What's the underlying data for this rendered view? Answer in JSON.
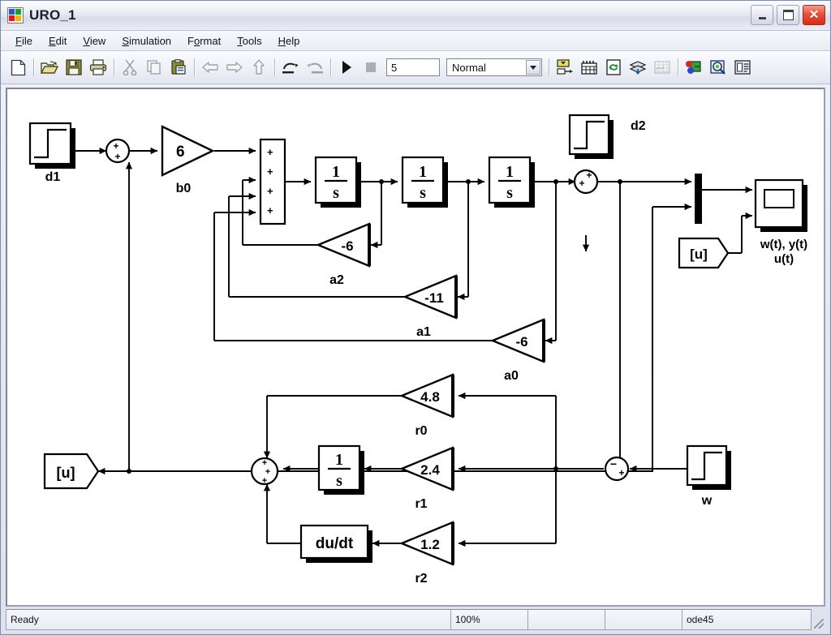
{
  "window": {
    "title": "URO_1",
    "icon": "simulink-model-icon",
    "buttons": {
      "minimize": "minimize-button",
      "maximize": "maximize-button",
      "close": "close-button"
    }
  },
  "menu": {
    "items": [
      {
        "label": "File",
        "mnemonic": "F"
      },
      {
        "label": "Edit",
        "mnemonic": "E"
      },
      {
        "label": "View",
        "mnemonic": "V"
      },
      {
        "label": "Simulation",
        "mnemonic": "S"
      },
      {
        "label": "Format",
        "mnemonic": "o"
      },
      {
        "label": "Tools",
        "mnemonic": "T"
      },
      {
        "label": "Help",
        "mnemonic": "H"
      }
    ]
  },
  "toolbar": {
    "buttons": [
      "new-model-icon",
      "open-model-icon",
      "save-icon",
      "print-icon",
      "cut-icon",
      "copy-icon",
      "paste-icon",
      "back-icon",
      "forward-icon",
      "up-level-icon",
      "undo-icon",
      "redo-icon",
      "start-simulation-icon",
      "stop-simulation-icon"
    ],
    "sim_time_value": "5",
    "sim_mode_value": "Normal",
    "right_buttons": [
      "library-browser-icon",
      "model-explorer-icon",
      "update-diagram-icon",
      "model-dependency-icon",
      "toggle-scope-manager-icon",
      "debug-icon",
      "model-advisor-icon",
      "block-parameters-icon"
    ]
  },
  "statusbar": {
    "status": "Ready",
    "zoom": "100%",
    "cell_b": "",
    "cell_c": "",
    "solver": "ode45"
  },
  "diagram": {
    "title": "URO_1 control system block diagram",
    "blocks": {
      "d1": {
        "type": "step",
        "label": "d1"
      },
      "d2": {
        "type": "step",
        "label": "d2"
      },
      "w": {
        "type": "step",
        "label": "w"
      },
      "sum_in": {
        "type": "sum-round",
        "signs": [
          "+",
          "+"
        ]
      },
      "b0": {
        "type": "gain",
        "value": "6",
        "label": "b0"
      },
      "sum_state": {
        "type": "sum-rect",
        "signs": [
          "+",
          "+",
          "+",
          "+"
        ]
      },
      "int1": {
        "type": "integrator",
        "value": "1/s"
      },
      "int2": {
        "type": "integrator",
        "value": "1/s"
      },
      "int3": {
        "type": "integrator",
        "value": "1/s"
      },
      "a2": {
        "type": "gain",
        "value": "-6",
        "label": "a2"
      },
      "a1": {
        "type": "gain",
        "value": "-11",
        "label": "a1"
      },
      "a0": {
        "type": "gain",
        "value": "-6",
        "label": "a0"
      },
      "sum_d2": {
        "type": "sum-round",
        "signs": [
          "+",
          "+"
        ]
      },
      "mux": {
        "type": "mux",
        "inputs": 2
      },
      "scope": {
        "type": "scope",
        "label_line1": "w(t), y(t)",
        "label_line2": "u(t)"
      },
      "from_u_scope": {
        "type": "from",
        "tag": "[u]"
      },
      "goto_u": {
        "type": "goto",
        "tag": "[u]"
      },
      "sum_err": {
        "type": "sum-round",
        "signs": [
          "-",
          "+"
        ]
      },
      "sum_ctrl": {
        "type": "sum-round",
        "signs": [
          "+",
          "+",
          "+"
        ]
      },
      "r0": {
        "type": "gain",
        "value": "4.8",
        "label": "r0"
      },
      "r1": {
        "type": "gain",
        "value": "2.4",
        "label": "r1"
      },
      "r2": {
        "type": "gain",
        "value": "1.2",
        "label": "r2"
      },
      "ctrl_int": {
        "type": "integrator",
        "value": "1/s"
      },
      "ctrl_der": {
        "type": "derivative",
        "value": "du/dt"
      }
    },
    "text": {
      "one": "1",
      "s": "s",
      "dudt": "du/dt",
      "u_tag": "[u]",
      "plus": "+",
      "minus": "−",
      "gain_b0": "6",
      "gain_a2": "-6",
      "gain_a1": "-11",
      "gain_a0": "-6",
      "gain_r0": "4.8",
      "gain_r1": "2.4",
      "gain_r2": "1.2",
      "lbl_b0": "b0",
      "lbl_a2": "a2",
      "lbl_a1": "a1",
      "lbl_a0": "a0",
      "lbl_r0": "r0",
      "lbl_r1": "r1",
      "lbl_r2": "r2",
      "lbl_d1": "d1",
      "lbl_d2": "d2",
      "lbl_w": "w",
      "scope_l1": "w(t), y(t)",
      "scope_l2": "u(t)"
    },
    "colors": {
      "line": "#000000",
      "block_fill": "#ffffff",
      "shadow": "#000000",
      "canvas": "#ffffff"
    }
  }
}
